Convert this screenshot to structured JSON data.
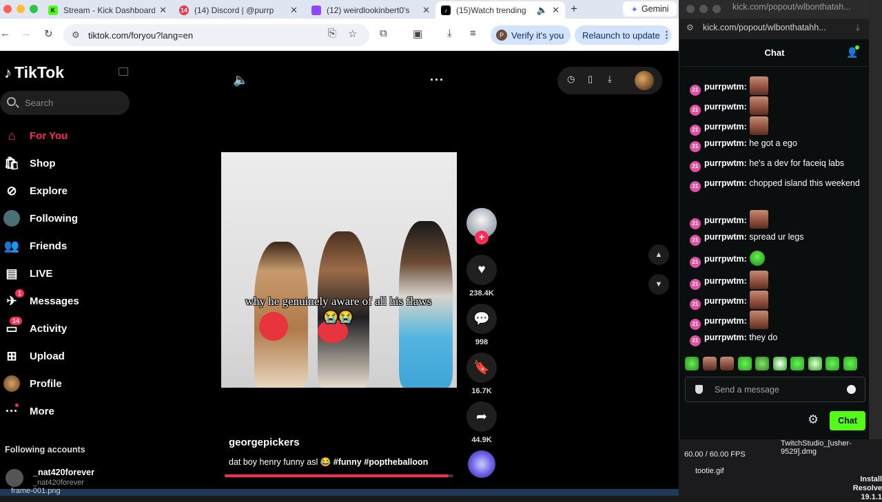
{
  "browser": {
    "tabs": [
      {
        "title": "Stream - Kick Dashboard",
        "favicon_color": "#53fc18",
        "favicon_letter": "K"
      },
      {
        "title": "(14) Discord | @purrp",
        "favicon_color": "#e8344e",
        "favicon_letter": "14"
      },
      {
        "title": "(12) weirdlookinbert0's",
        "favicon_color": "#9146ff",
        "favicon_letter": ""
      },
      {
        "title": "(15)Watch trending",
        "favicon_color": "#000000",
        "favicon_letter": "♪"
      }
    ],
    "gemini_tab": "Gemini",
    "url": "tiktok.com/foryou?lang=en",
    "verify_label": "Verify it's you",
    "relaunch_label": "Relaunch to update"
  },
  "tiktok": {
    "logo": "TikTok",
    "search_placeholder": "Search",
    "nav": [
      {
        "label": "For You",
        "icon": "home-icon",
        "active": true
      },
      {
        "label": "Shop",
        "icon": "shop-icon"
      },
      {
        "label": "Explore",
        "icon": "explore-icon"
      },
      {
        "label": "Following",
        "icon": "following-avatar-icon"
      },
      {
        "label": "Friends",
        "icon": "friends-icon"
      },
      {
        "label": "LIVE",
        "icon": "live-icon"
      },
      {
        "label": "Messages",
        "icon": "messages-icon",
        "badge": "1"
      },
      {
        "label": "Activity",
        "icon": "activity-icon",
        "badge": "14"
      },
      {
        "label": "Upload",
        "icon": "upload-icon"
      },
      {
        "label": "Profile",
        "icon": "profile-avatar-icon"
      },
      {
        "label": "More",
        "icon": "more-icon"
      }
    ],
    "following_accounts_heading": "Following accounts",
    "following_account": {
      "name": "_nat420forever",
      "handle": "_nat420forever"
    },
    "video": {
      "caption": "why he genuinely aware of all his flaws 😭😭",
      "author": "georgepickers",
      "description_text": "dat boy henry funny asl 😂",
      "hashtags": [
        "#funny",
        "#poptheballoon"
      ],
      "likes": "238.4K",
      "comments": "998",
      "saves": "16.7K",
      "shares": "44.9K",
      "progress": 0.98
    }
  },
  "kick": {
    "window_title": "kick.com/popout/wlbonthatah...",
    "url": "kick.com/popout/wlbonthatahh...",
    "header": "Chat",
    "badge_text": "21",
    "messages": [
      {
        "user": "purrpwtm:",
        "text": "",
        "emote": "face"
      },
      {
        "user": "purrpwtm:",
        "text": "",
        "emote": "face"
      },
      {
        "user": "purrpwtm:",
        "text": "",
        "emote": "face"
      },
      {
        "user": "purrpwtm:",
        "text": "he got a ego"
      },
      {
        "user": "purrpwtm:",
        "text": "he's a dev for faceiq labs"
      },
      {
        "user": "purrpwtm:",
        "text": "chopped island this weekend"
      },
      {
        "user": "purrpwtm:",
        "text": "",
        "emote": "face"
      },
      {
        "user": "purrpwtm:",
        "text": "spread ur legs"
      },
      {
        "user": "purrpwtm:",
        "text": "",
        "emote": "green"
      },
      {
        "user": "purrpwtm:",
        "text": "",
        "emote": "face"
      },
      {
        "user": "purrpwtm:",
        "text": "",
        "emote": "face"
      },
      {
        "user": "purrpwtm:",
        "text": "",
        "emote": "face"
      },
      {
        "user": "purrpwtm:",
        "text": "they do"
      }
    ],
    "send_placeholder": "Send a message",
    "chat_button": "Chat"
  },
  "desktop": {
    "fps": "60.00 / 60.00 FPS",
    "tootie": "tootie.gif",
    "twitch_studio": "TwitchStudio_[usher-9529].dmg",
    "install": "Install Resolve 19.1.1",
    "frame_file": "frame-001.png"
  }
}
